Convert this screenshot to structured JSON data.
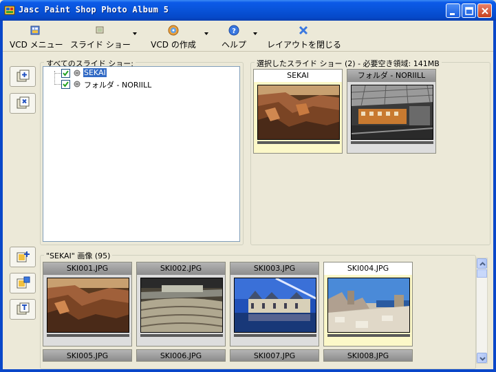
{
  "window": {
    "title": "Jasc Paint Shop Photo Album 5"
  },
  "toolbar": {
    "items": [
      {
        "label": "VCD メニュー",
        "icon": "vcd-menu-icon"
      },
      {
        "label": "スライド ショー",
        "icon": "slideshow-icon"
      },
      {
        "label": "VCD の作成",
        "icon": "create-vcd-icon"
      },
      {
        "label": "ヘルプ",
        "icon": "help-icon"
      },
      {
        "label": "レイアウトを閉じる",
        "icon": "close-layout-icon"
      }
    ]
  },
  "all_slideshows": {
    "label": "すべてのスライド ショー:",
    "items": [
      {
        "label": "SEKAI",
        "checked": true,
        "selected": true
      },
      {
        "label": "フォルダ - NORIILL",
        "checked": true,
        "selected": false
      }
    ]
  },
  "selected_slideshows": {
    "label": "選択したスライド ショー (2) - 必要空き領域: 141MB",
    "thumbs": [
      {
        "title": "SEKAI",
        "selected": true
      },
      {
        "title": "フォルダ - NORIILL",
        "selected": false
      }
    ]
  },
  "images": {
    "label": "\"SEKAI\" 画像 (95)",
    "thumbs": [
      {
        "title": "SKI001.JPG",
        "selected": false
      },
      {
        "title": "SKI002.JPG",
        "selected": false
      },
      {
        "title": "SKI003.JPG",
        "selected": false
      },
      {
        "title": "SKI004.JPG",
        "selected": true
      }
    ],
    "next_row": [
      "SKI005.JPG",
      "SKI006.JPG",
      "SKI007.JPG",
      "SKI008.JPG"
    ]
  },
  "colors": {
    "titlebar": "#0853d8",
    "selection": "#316ac5",
    "selected_thumb_bg": "#fcf8c8"
  }
}
